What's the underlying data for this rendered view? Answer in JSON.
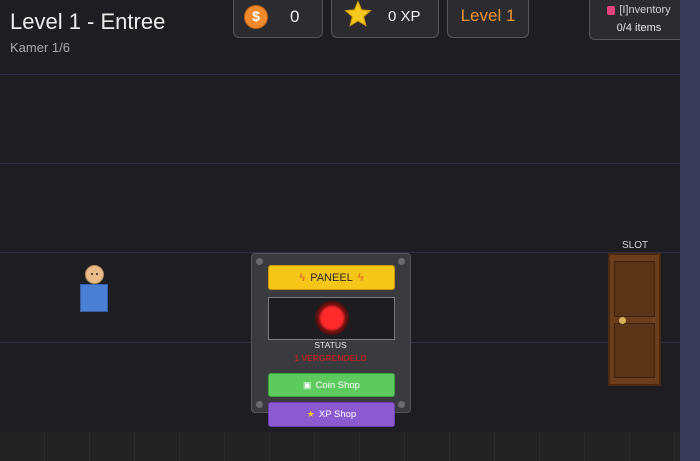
{
  "header": {
    "title": "Level 1 - Entree",
    "room": "Kamer 1/6"
  },
  "hud": {
    "coin_icon": "coin-icon",
    "coin_symbol": "$",
    "coins": "0",
    "xp_icon": "star-icon",
    "xp": "0 XP",
    "level": "Level 1",
    "inventory_label": "[I]nventory",
    "inventory_count": "0/4 items"
  },
  "door": {
    "label": "SLOT"
  },
  "panel": {
    "header": "PANEEL",
    "header_icon": "lightning-icon",
    "status_label": "STATUS",
    "status_value": "1 VERGRENDELD",
    "coin_shop": "Coin Shop",
    "xp_shop": "XP Shop"
  },
  "colors": {
    "level": "#f0952c",
    "panel_header": "#f5c518",
    "coin_shop": "#5dca5e",
    "xp_shop": "#8c5ad0",
    "led": "#ff2a2a",
    "status": "#b02424"
  }
}
